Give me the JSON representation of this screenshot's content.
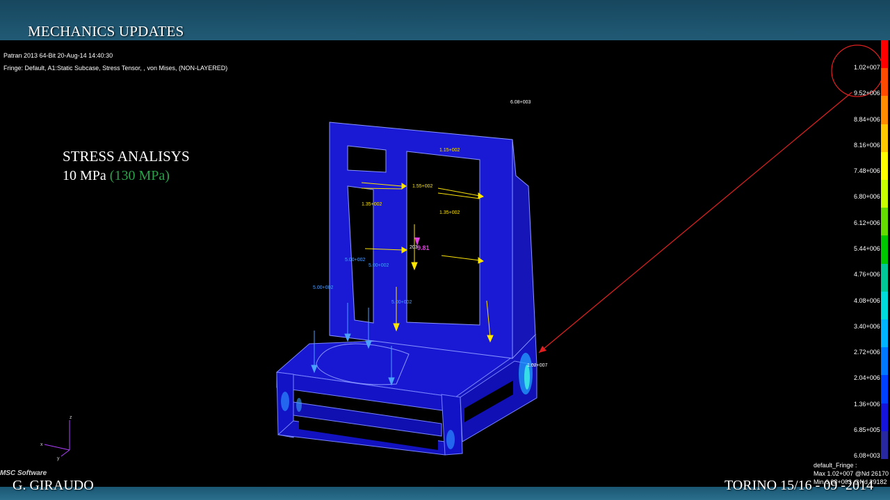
{
  "slide": {
    "title": "MECHANICS UPDATES",
    "author": "G. GIRAUDO",
    "place_date": "TORINO 15/16 - 09 -2014"
  },
  "patran": {
    "header_line1": "Patran 2013 64-Bit 20-Aug-14 14:40:30",
    "header_line2": "Fringe: Default, A1:Static Subcase, Stress Tensor, , von Mises, (NON-LAYERED)",
    "fringe_title": "default_Fringe :",
    "fringe_max": "Max 1.02+007 @Nd 26170",
    "fringe_min": "Min 6.08+003 @Nd 39182",
    "logo": "MSC Software"
  },
  "analysis": {
    "title": "STRESS ANALISYS",
    "value": "10 MPa",
    "allowable": "(130 MPa)"
  },
  "colorbar": {
    "labels": [
      "1.02+007",
      "9.52+006",
      "8.84+006",
      "8.16+006",
      "7.48+006",
      "6.80+006",
      "6.12+006",
      "5.44+006",
      "4.76+006",
      "4.08+006",
      "3.40+006",
      "2.72+006",
      "2.04+006",
      "1.36+006",
      "6.85+005",
      "6.08+003"
    ],
    "colors": [
      "#ff0000",
      "#ff4a00",
      "#ff8c00",
      "#ffc800",
      "#ffff00",
      "#c8ff00",
      "#64dc00",
      "#00c800",
      "#00c896",
      "#00dcdc",
      "#00b4ff",
      "#0078ff",
      "#0040ff",
      "#1414dc",
      "#2828a0"
    ]
  },
  "annotations": {
    "max_top": "6.08+003",
    "max_pointer": "1.02+007",
    "load_a": "1.15+002",
    "load_b": "1.35+002",
    "load_c": "1.55+002",
    "load_d": "1.35+002",
    "load_e": "5.00+002",
    "load_f": "5.00+002",
    "load_g": "5.00+002",
    "load_h": "5.00+002",
    "marker_label": "203",
    "marker_value": "9.81"
  },
  "axes": {
    "x": "x",
    "y": "y",
    "z": "z"
  }
}
